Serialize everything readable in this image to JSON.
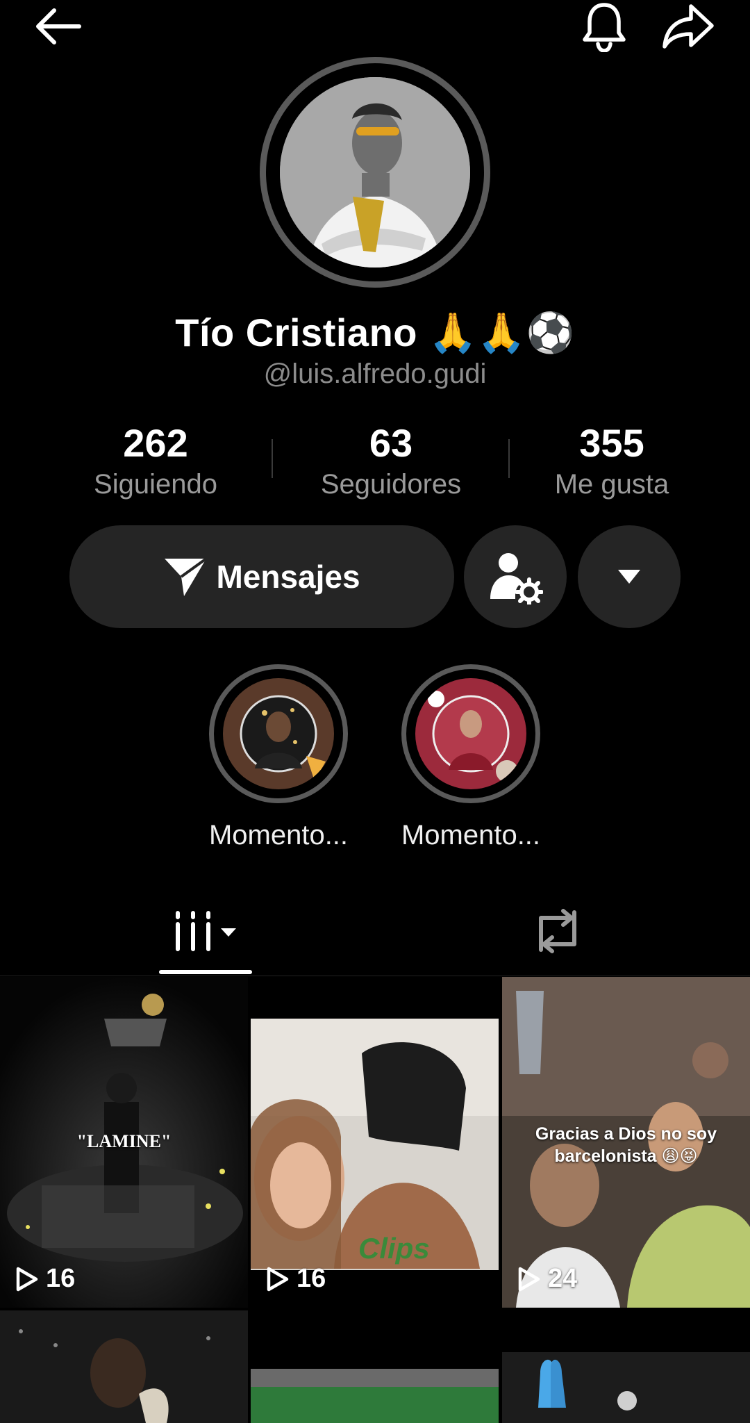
{
  "profile": {
    "display_name": "Tío Cristiano 🙏🙏⚽",
    "username": "@luis.alfredo.gudi"
  },
  "stats": [
    {
      "value": "262",
      "label": "Siguiendo"
    },
    {
      "value": "63",
      "label": "Seguidores"
    },
    {
      "value": "355",
      "label": "Me gusta"
    }
  ],
  "actions": {
    "message_label": "Mensajes"
  },
  "highlights": [
    {
      "label": "Momento..."
    },
    {
      "label": "Momento..."
    }
  ],
  "icons": {
    "back": "back-arrow-icon",
    "bell": "bell-icon",
    "share": "share-icon",
    "send": "paper-plane-icon",
    "user_settings": "user-settings-icon",
    "dropdown": "triangle-down-icon",
    "grid_tab": "videos-grid-icon",
    "repost_tab": "repost-icon",
    "play": "play-icon"
  },
  "videos": [
    {
      "views": "16",
      "caption": "\"LAMINE\""
    },
    {
      "views": "16",
      "caption": "Clips"
    },
    {
      "views": "24",
      "caption": "Gracias a Dios no soy barcelonista 😩😝"
    },
    {
      "views": ""
    },
    {
      "views": ""
    },
    {
      "views": ""
    }
  ],
  "colors": {
    "background": "#000000",
    "button": "#252525",
    "muted_text": "#8c8c8c",
    "ring": "#5a5a5a"
  }
}
